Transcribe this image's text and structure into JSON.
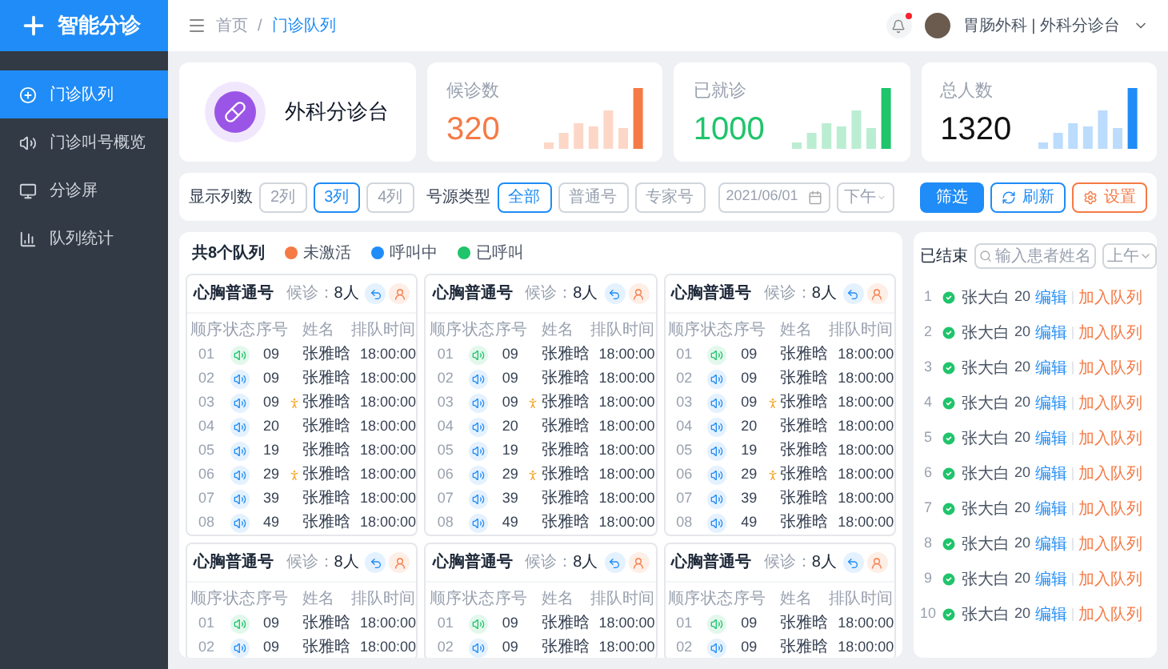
{
  "sidebar": {
    "logo": "智能分诊",
    "items": [
      {
        "label": "门诊队列",
        "selected": true
      },
      {
        "label": "门诊叫号概览",
        "selected": false
      },
      {
        "label": "分诊屏",
        "selected": false
      },
      {
        "label": "队列统计",
        "selected": false
      }
    ]
  },
  "header": {
    "breadcrumb": [
      "首页",
      "门诊队列"
    ],
    "separator": "/",
    "notification": true,
    "user": "胃肠外科 | 外科分诊台"
  },
  "desk": {
    "title": "外科分诊台"
  },
  "stats": [
    {
      "label": "候诊数",
      "value": "320",
      "color": "#f57a45"
    },
    {
      "label": "已就诊",
      "value": "1000",
      "color": "#1fc46b"
    },
    {
      "label": "总人数",
      "value": "1320",
      "color": "#1f8cf7"
    }
  ],
  "filters": {
    "columns_label": "显示列数",
    "columns": [
      {
        "label": "2列",
        "selected": false
      },
      {
        "label": "3列",
        "selected": true
      },
      {
        "label": "4列",
        "selected": false
      }
    ],
    "type_label": "号源类型",
    "types": [
      {
        "label": "全部",
        "selected": true
      },
      {
        "label": "普通号",
        "selected": false
      },
      {
        "label": "专家号",
        "selected": false
      }
    ],
    "date": "2021/06/01",
    "period": "下午",
    "buttons": [
      {
        "label": "筛选",
        "kind": "primary"
      },
      {
        "label": "刷新",
        "kind": "refresh"
      },
      {
        "label": "设置",
        "kind": "settings"
      }
    ]
  },
  "queues": {
    "title": "共8个队列",
    "legend": [
      {
        "label": "未激活",
        "color": "#f57a45"
      },
      {
        "label": "呼叫中",
        "color": "#1f8cf7"
      },
      {
        "label": "已呼叫",
        "color": "#1fc46b"
      }
    ],
    "cards": [
      {
        "name": "心胸普通号",
        "waiting_label": "候诊：",
        "waiting": "8人",
        "columns": [
          "顺序",
          "状态",
          "序号",
          "姓名",
          "排队时间"
        ],
        "rows": [
          {
            "order": "01",
            "called": true,
            "number": "09",
            "name": "张雅晗",
            "flag": false,
            "time": "18:00:00"
          },
          {
            "order": "02",
            "called": false,
            "number": "09",
            "name": "张雅晗",
            "flag": false,
            "time": "18:00:00"
          },
          {
            "order": "03",
            "called": false,
            "number": "09",
            "name": "张雅晗",
            "flag": true,
            "time": "18:00:00"
          },
          {
            "order": "04",
            "called": false,
            "number": "20",
            "name": "张雅晗",
            "flag": false,
            "time": "18:00:00"
          },
          {
            "order": "05",
            "called": false,
            "number": "19",
            "name": "张雅晗",
            "flag": false,
            "time": "18:00:00"
          },
          {
            "order": "06",
            "called": false,
            "number": "29",
            "name": "张雅晗",
            "flag": true,
            "time": "18:00:00"
          },
          {
            "order": "07",
            "called": false,
            "number": "39",
            "name": "张雅晗",
            "flag": false,
            "time": "18:00:00"
          },
          {
            "order": "08",
            "called": false,
            "number": "49",
            "name": "张雅晗",
            "flag": false,
            "time": "18:00:00"
          }
        ]
      },
      {
        "name": "心胸普通号",
        "waiting_label": "候诊：",
        "waiting": "8人",
        "columns": [
          "顺序",
          "状态",
          "序号",
          "姓名",
          "排队时间"
        ],
        "rows": [
          {
            "order": "01",
            "called": true,
            "number": "09",
            "name": "张雅晗",
            "flag": false,
            "time": "18:00:00"
          },
          {
            "order": "02",
            "called": false,
            "number": "09",
            "name": "张雅晗",
            "flag": false,
            "time": "18:00:00"
          },
          {
            "order": "03",
            "called": false,
            "number": "09",
            "name": "张雅晗",
            "flag": true,
            "time": "18:00:00"
          },
          {
            "order": "04",
            "called": false,
            "number": "20",
            "name": "张雅晗",
            "flag": false,
            "time": "18:00:00"
          },
          {
            "order": "05",
            "called": false,
            "number": "19",
            "name": "张雅晗",
            "flag": false,
            "time": "18:00:00"
          },
          {
            "order": "06",
            "called": false,
            "number": "29",
            "name": "张雅晗",
            "flag": true,
            "time": "18:00:00"
          },
          {
            "order": "07",
            "called": false,
            "number": "39",
            "name": "张雅晗",
            "flag": false,
            "time": "18:00:00"
          },
          {
            "order": "08",
            "called": false,
            "number": "49",
            "name": "张雅晗",
            "flag": false,
            "time": "18:00:00"
          }
        ]
      },
      {
        "name": "心胸普通号",
        "waiting_label": "候诊：",
        "waiting": "8人",
        "columns": [
          "顺序",
          "状态",
          "序号",
          "姓名",
          "排队时间"
        ],
        "rows": [
          {
            "order": "01",
            "called": true,
            "number": "09",
            "name": "张雅晗",
            "flag": false,
            "time": "18:00:00"
          },
          {
            "order": "02",
            "called": false,
            "number": "09",
            "name": "张雅晗",
            "flag": false,
            "time": "18:00:00"
          },
          {
            "order": "03",
            "called": false,
            "number": "09",
            "name": "张雅晗",
            "flag": true,
            "time": "18:00:00"
          },
          {
            "order": "04",
            "called": false,
            "number": "20",
            "name": "张雅晗",
            "flag": false,
            "time": "18:00:00"
          },
          {
            "order": "05",
            "called": false,
            "number": "19",
            "name": "张雅晗",
            "flag": false,
            "time": "18:00:00"
          },
          {
            "order": "06",
            "called": false,
            "number": "29",
            "name": "张雅晗",
            "flag": true,
            "time": "18:00:00"
          },
          {
            "order": "07",
            "called": false,
            "number": "39",
            "name": "张雅晗",
            "flag": false,
            "time": "18:00:00"
          },
          {
            "order": "08",
            "called": false,
            "number": "49",
            "name": "张雅晗",
            "flag": false,
            "time": "18:00:00"
          }
        ]
      },
      {
        "name": "心胸普通号",
        "waiting_label": "候诊：",
        "waiting": "8人",
        "columns": [
          "顺序",
          "状态",
          "序号",
          "姓名",
          "排队时间"
        ],
        "rows": [
          {
            "order": "01",
            "called": true,
            "number": "09",
            "name": "张雅晗",
            "flag": false,
            "time": "18:00:00"
          },
          {
            "order": "02",
            "called": false,
            "number": "09",
            "name": "张雅晗",
            "flag": false,
            "time": "18:00:00"
          }
        ]
      },
      {
        "name": "心胸普通号",
        "waiting_label": "候诊：",
        "waiting": "8人",
        "columns": [
          "顺序",
          "状态",
          "序号",
          "姓名",
          "排队时间"
        ],
        "rows": [
          {
            "order": "01",
            "called": true,
            "number": "09",
            "name": "张雅晗",
            "flag": false,
            "time": "18:00:00"
          },
          {
            "order": "02",
            "called": false,
            "number": "09",
            "name": "张雅晗",
            "flag": false,
            "time": "18:00:00"
          }
        ]
      },
      {
        "name": "心胸普通号",
        "waiting_label": "候诊：",
        "waiting": "8人",
        "columns": [
          "顺序",
          "状态",
          "序号",
          "姓名",
          "排队时间"
        ],
        "rows": [
          {
            "order": "01",
            "called": true,
            "number": "09",
            "name": "张雅晗",
            "flag": false,
            "time": "18:00:00"
          },
          {
            "order": "02",
            "called": false,
            "number": "09",
            "name": "张雅晗",
            "flag": false,
            "time": "18:00:00"
          }
        ]
      }
    ]
  },
  "finished": {
    "title": "已结束",
    "search_placeholder": "输入患者姓名",
    "period": "上午",
    "rows": [
      {
        "index": "1",
        "name": "张大白",
        "number": "20",
        "edit": "编辑",
        "add": "加入队列"
      },
      {
        "index": "2",
        "name": "张大白",
        "number": "20",
        "edit": "编辑",
        "add": "加入队列"
      },
      {
        "index": "3",
        "name": "张大白",
        "number": "20",
        "edit": "编辑",
        "add": "加入队列"
      },
      {
        "index": "4",
        "name": "张大白",
        "number": "20",
        "edit": "编辑",
        "add": "加入队列"
      },
      {
        "index": "5",
        "name": "张大白",
        "number": "20",
        "edit": "编辑",
        "add": "加入队列"
      },
      {
        "index": "6",
        "name": "张大白",
        "number": "20",
        "edit": "编辑",
        "add": "加入队列"
      },
      {
        "index": "7",
        "name": "张大白",
        "number": "20",
        "edit": "编辑",
        "add": "加入队列"
      },
      {
        "index": "8",
        "name": "张大白",
        "number": "20",
        "edit": "编辑",
        "add": "加入队列"
      },
      {
        "index": "9",
        "name": "张大白",
        "number": "20",
        "edit": "编辑",
        "add": "加入队列"
      },
      {
        "index": "10",
        "name": "张大白",
        "number": "20",
        "edit": "编辑",
        "add": "加入队列"
      }
    ]
  }
}
